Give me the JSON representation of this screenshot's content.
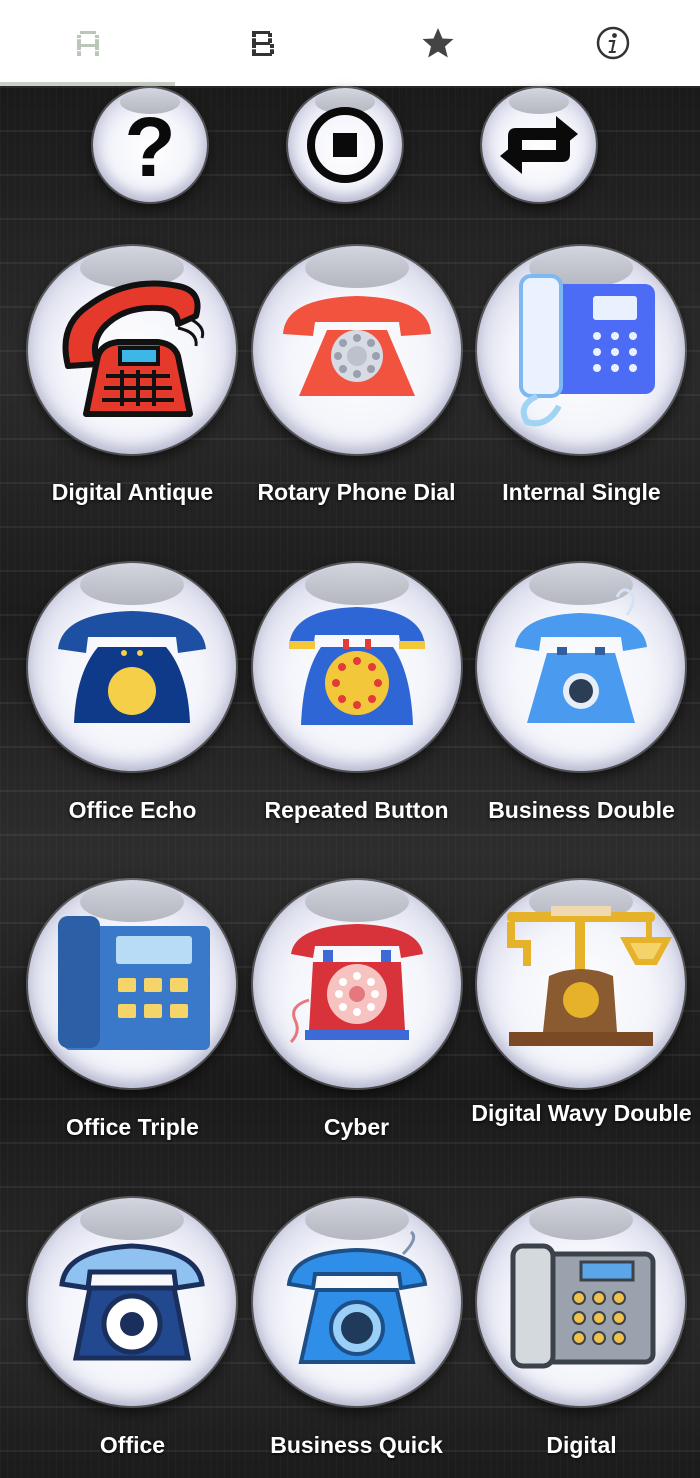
{
  "tabs": [
    {
      "icon": "alphabet-a-icon",
      "active": true
    },
    {
      "icon": "alphabet-b-icon",
      "active": false
    },
    {
      "icon": "star-icon",
      "active": false
    },
    {
      "icon": "info-icon",
      "active": false
    }
  ],
  "controls": [
    {
      "icon": "help-question-icon"
    },
    {
      "icon": "stop-icon"
    },
    {
      "icon": "repeat-icon"
    }
  ],
  "sounds": [
    {
      "label": "Digital Antique",
      "icon": "red-digital-antique-phone-icon"
    },
    {
      "label": "Rotary Phone Dial",
      "icon": "red-rotary-phone-icon"
    },
    {
      "label": "Internal Single",
      "icon": "blue-office-desk-phone-icon"
    },
    {
      "label": "Office Echo",
      "icon": "navy-yellow-dial-phone-icon"
    },
    {
      "label": "Repeated Button",
      "icon": "blue-yellow-rotary-phone-icon"
    },
    {
      "label": "Business Double",
      "icon": "light-blue-phone-icon"
    },
    {
      "label": "Office Triple",
      "icon": "blue-keypad-office-phone-icon"
    },
    {
      "label": "Cyber",
      "icon": "red-vintage-rotary-phone-icon"
    },
    {
      "label": "Digital Wavy Double",
      "icon": "antique-brass-candlestick-phone-icon"
    },
    {
      "label": "Office",
      "icon": "dark-blue-rotary-phone-icon"
    },
    {
      "label": "Business Quick",
      "icon": "blue-rotary-phone-icon"
    },
    {
      "label": "Digital",
      "icon": "grey-digital-desk-phone-icon"
    }
  ],
  "colors": {
    "tab_active": "#9fb39c",
    "tab_inactive": "#3a3a3a",
    "label_text": "#ffffff"
  }
}
